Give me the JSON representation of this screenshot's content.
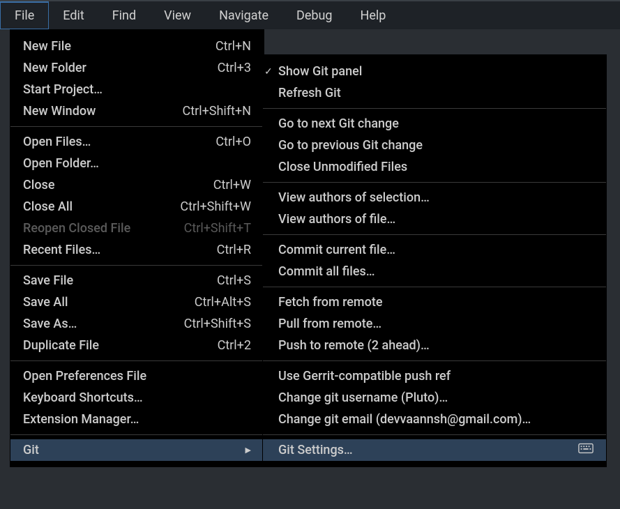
{
  "menubar": {
    "items": [
      {
        "label": "File",
        "active": true
      },
      {
        "label": "Edit"
      },
      {
        "label": "Find"
      },
      {
        "label": "View"
      },
      {
        "label": "Navigate"
      },
      {
        "label": "Debug"
      },
      {
        "label": "Help"
      }
    ]
  },
  "fileMenu": {
    "groups": [
      [
        {
          "label": "New File",
          "shortcut": "Ctrl+N"
        },
        {
          "label": "New Folder",
          "shortcut": "Ctrl+3"
        },
        {
          "label": "Start Project…",
          "shortcut": ""
        },
        {
          "label": "New Window",
          "shortcut": "Ctrl+Shift+N"
        }
      ],
      [
        {
          "label": "Open Files…",
          "shortcut": "Ctrl+O"
        },
        {
          "label": "Open Folder…",
          "shortcut": ""
        },
        {
          "label": "Close",
          "shortcut": "Ctrl+W"
        },
        {
          "label": "Close All",
          "shortcut": "Ctrl+Shift+W"
        },
        {
          "label": "Reopen Closed File",
          "shortcut": "Ctrl+Shift+T",
          "disabled": true
        },
        {
          "label": "Recent Files…",
          "shortcut": "Ctrl+R"
        }
      ],
      [
        {
          "label": "Save File",
          "shortcut": "Ctrl+S"
        },
        {
          "label": "Save All",
          "shortcut": "Ctrl+Alt+S"
        },
        {
          "label": "Save As…",
          "shortcut": "Ctrl+Shift+S"
        },
        {
          "label": "Duplicate File",
          "shortcut": "Ctrl+2"
        }
      ],
      [
        {
          "label": "Open Preferences File",
          "shortcut": ""
        },
        {
          "label": "Keyboard Shortcuts…",
          "shortcut": ""
        },
        {
          "label": "Extension Manager…",
          "shortcut": ""
        }
      ],
      [
        {
          "label": "Git",
          "shortcut": "",
          "submenu": true,
          "highlighted": true
        }
      ]
    ]
  },
  "gitSubmenu": {
    "groups": [
      [
        {
          "label": "Show Git panel",
          "checked": true
        },
        {
          "label": "Refresh Git"
        }
      ],
      [
        {
          "label": "Go to next Git change"
        },
        {
          "label": "Go to previous Git change"
        },
        {
          "label": "Close Unmodified Files"
        }
      ],
      [
        {
          "label": "View authors of selection…"
        },
        {
          "label": "View authors of file…"
        }
      ],
      [
        {
          "label": "Commit current file…"
        },
        {
          "label": "Commit all files…"
        }
      ],
      [
        {
          "label": "Fetch from remote"
        },
        {
          "label": "Pull from remote…"
        },
        {
          "label": "Push to remote (2 ahead)…"
        }
      ],
      [
        {
          "label": "Use Gerrit-compatible push ref"
        },
        {
          "label": "Change git username (Pluto)…"
        },
        {
          "label": "Change git email (devvaannsh@gmail.com)…"
        }
      ],
      [
        {
          "label": "Git Settings…",
          "highlighted": true,
          "keyboardIcon": true
        }
      ]
    ]
  }
}
